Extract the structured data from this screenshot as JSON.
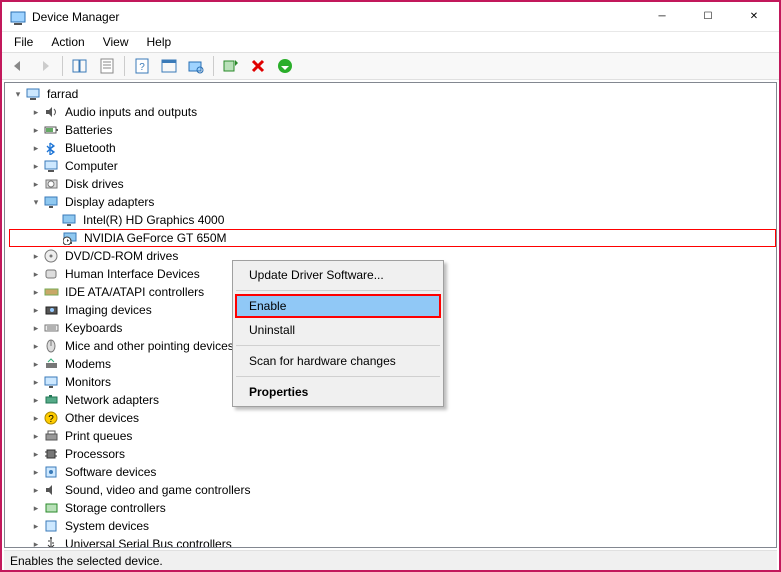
{
  "window": {
    "title": "Device Manager"
  },
  "menu": {
    "file": "File",
    "action": "Action",
    "view": "View",
    "help": "Help"
  },
  "tree": {
    "root": "farrad",
    "items": [
      "Audio inputs and outputs",
      "Batteries",
      "Bluetooth",
      "Computer",
      "Disk drives",
      "Display adapters",
      "DVD/CD-ROM drives",
      "Human Interface Devices",
      "IDE ATA/ATAPI controllers",
      "Imaging devices",
      "Keyboards",
      "Mice and other pointing devices",
      "Modems",
      "Monitors",
      "Network adapters",
      "Other devices",
      "Print queues",
      "Processors",
      "Software devices",
      "Sound, video and game controllers",
      "Storage controllers",
      "System devices",
      "Universal Serial Bus controllers"
    ],
    "display_children": {
      "intel": "Intel(R) HD Graphics 4000",
      "nvidia": "NVIDIA GeForce GT 650M"
    }
  },
  "context_menu": {
    "update": "Update Driver Software...",
    "enable": "Enable",
    "uninstall": "Uninstall",
    "scan": "Scan for hardware changes",
    "properties": "Properties"
  },
  "status": "Enables the selected device."
}
